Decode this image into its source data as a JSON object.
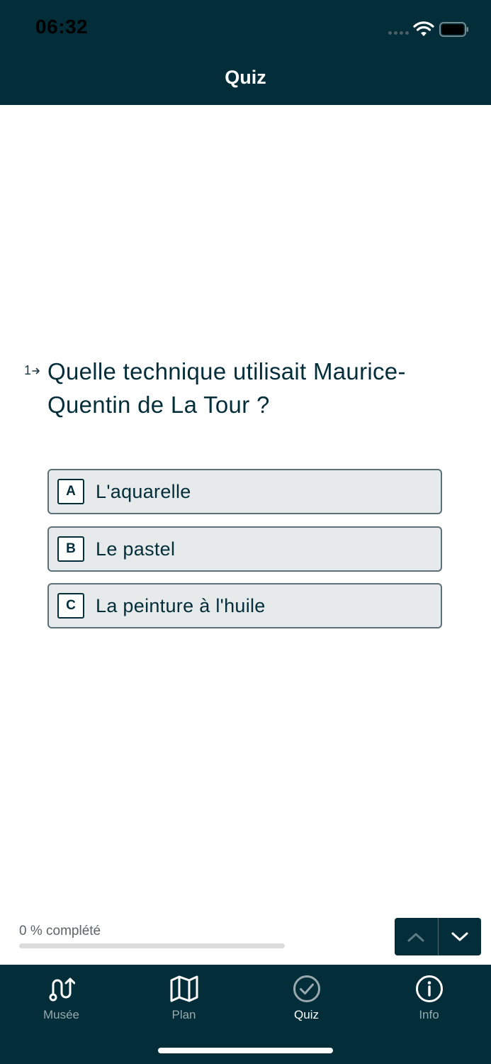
{
  "status_bar": {
    "time": "06:32"
  },
  "header": {
    "title": "Quiz"
  },
  "question": {
    "number": "1",
    "text": "Quelle technique utilisait Maurice-Quentin de La Tour ?"
  },
  "options": [
    {
      "key": "A",
      "label": "L'aquarelle"
    },
    {
      "key": "B",
      "label": "Le pastel"
    },
    {
      "key": "C",
      "label": "La peinture à l'huile"
    }
  ],
  "progress": {
    "label": "0 % complété",
    "fraction": 0
  },
  "tabbar": {
    "tabs": [
      {
        "label": "Musée",
        "icon": "route-icon",
        "active": false
      },
      {
        "label": "Plan",
        "icon": "map-icon",
        "active": false
      },
      {
        "label": "Quiz",
        "icon": "check-circle-icon",
        "active": true
      },
      {
        "label": "Info",
        "icon": "info-icon",
        "active": false
      }
    ]
  },
  "colors": {
    "primary": "#022d39",
    "option_background": "#e6eaeb",
    "option_border": "#5c7177",
    "inactive_tab": "#9aa9ad"
  }
}
